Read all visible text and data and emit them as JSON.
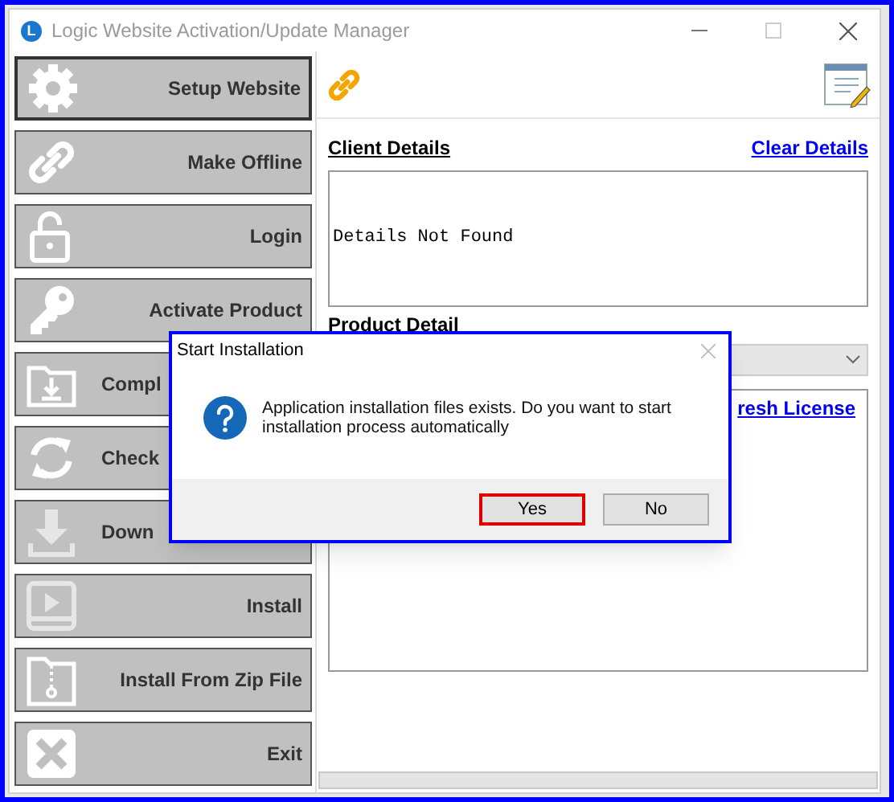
{
  "window": {
    "app_icon_letter": "L",
    "title": "Logic Website Activation/Update Manager"
  },
  "sidebar": {
    "items": [
      {
        "label": "Setup Website",
        "selected": true,
        "kind": "full"
      },
      {
        "label": "Make Offline",
        "selected": false,
        "kind": "full"
      },
      {
        "label": "Login",
        "selected": false,
        "kind": "full"
      },
      {
        "label": "Activate Product",
        "selected": false,
        "kind": "full"
      },
      {
        "label": "Compl",
        "selected": false,
        "kind": "covered"
      },
      {
        "label": "Check",
        "selected": false,
        "kind": "covered"
      },
      {
        "label": "Down",
        "selected": false,
        "kind": "covered"
      },
      {
        "label": "Install",
        "selected": false,
        "kind": "full"
      },
      {
        "label": "Install From Zip File",
        "selected": false,
        "kind": "full"
      },
      {
        "label": "Exit",
        "selected": false,
        "kind": "full"
      }
    ]
  },
  "client": {
    "heading": "Client Details",
    "clear_link": "Clear Details",
    "text": "Details Not Found"
  },
  "product": {
    "heading": "Product Detail",
    "license_link": "resh License"
  },
  "dialog": {
    "title": "Start Installation",
    "message": "Application installation files exists. Do you want to start installation process automatically",
    "buttons": [
      {
        "label": "Yes",
        "selected": true
      },
      {
        "label": "No",
        "selected": false
      }
    ]
  }
}
